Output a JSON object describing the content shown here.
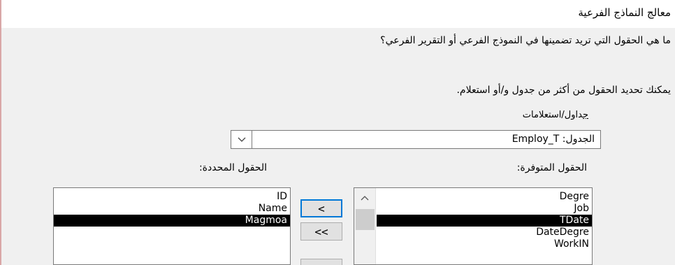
{
  "window": {
    "title": "معالج النماذج الفرعية"
  },
  "page": {
    "question": "ما هي الحقول التي تريد تضمينها في النموذج الفرعي أو التقرير الفرعي؟",
    "hint": "يمكنك تحديد الحقول من أكثر من جدول و/أو استعلام."
  },
  "combo": {
    "label_first_char": "ج",
    "label_rest": "داول/استعلامات",
    "value": "الجدول: Employ_T",
    "dropdown_icon": "chevron-down-icon"
  },
  "available": {
    "label": "الحقول المتوفرة:",
    "items": [
      "Degre",
      "Job",
      "TDate",
      "DateDegre",
      "WorkIN"
    ],
    "selected_index": 2
  },
  "selected": {
    "label": "الحقول المحددة:",
    "items": [
      "ID",
      "Name",
      "Magmoa"
    ],
    "selected_index": 2
  },
  "buttons": {
    "add_one": "<",
    "add_all": "<<",
    "next": ""
  },
  "colors": {
    "focus_border": "#0078d7",
    "selection_bg": "#000000",
    "header_bg": "#ffffff",
    "body_bg": "#f0f0f0"
  }
}
